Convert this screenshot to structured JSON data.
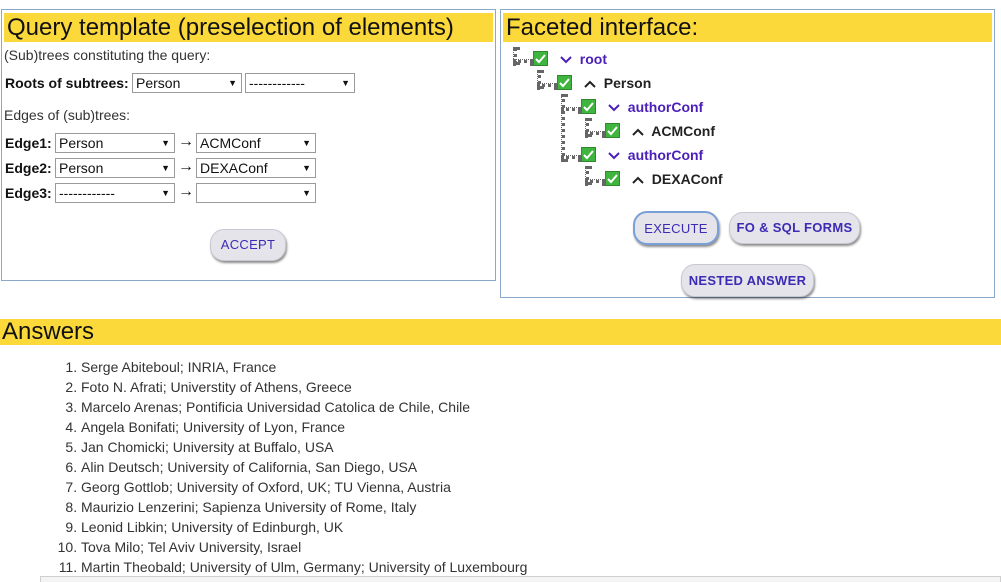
{
  "query_template": {
    "title": "Query template (preselection of elements)",
    "subtrees_caption": "(Sub)trees constituting the query:",
    "roots_label": "Roots of subtrees:",
    "root_select_1": "Person",
    "root_select_2": "------------",
    "edges_caption": "Edges of (sub)trees:",
    "edges": [
      {
        "label": "Edge1:",
        "from": "Person",
        "to": "ACMConf"
      },
      {
        "label": "Edge2:",
        "from": "Person",
        "to": "DEXAConf"
      },
      {
        "label": "Edge3:",
        "from": "------------",
        "to": ""
      }
    ],
    "arrow": "→",
    "accept_label": "ACCEPT"
  },
  "faceted": {
    "title": "Faceted interface:",
    "tree": [
      {
        "label": "root",
        "chevron": "down",
        "color": "#4a1fb8"
      },
      {
        "label": "Person",
        "chevron": "up",
        "color": "#222222"
      },
      {
        "label": "authorConf",
        "chevron": "down",
        "color": "#4a1fb8"
      },
      {
        "label": "ACMConf",
        "chevron": "up",
        "color": "#222222"
      },
      {
        "label": "authorConf",
        "chevron": "down",
        "color": "#4a1fb8"
      },
      {
        "label": "DEXAConf",
        "chevron": "up",
        "color": "#222222"
      }
    ],
    "execute_label": "EXECUTE",
    "fo_sql_label": "FO & SQL FORMS",
    "nested_label": "NESTED ANSWER"
  },
  "answers": {
    "title": "Answers",
    "items": [
      "Serge Abiteboul; INRIA, France",
      "Foto N. Afrati; Universtity of Athens, Greece",
      "Marcelo Arenas; Pontificia Universidad Catolica de Chile, Chile",
      "Angela Bonifati; University of Lyon, France",
      "Jan Chomicki; University at Buffalo, USA",
      "Alin Deutsch; University of California, San Diego, USA",
      "Georg Gottlob; University of Oxford, UK; TU Vienna, Austria",
      "Maurizio Lenzerini; Sapienza University of Rome, Italy",
      "Leonid Libkin; University of Edinburgh, UK",
      "Tova Milo; Tel Aviv University, Israel",
      "Martin Theobald; University of Ulm, Germany; University of Luxembourg"
    ]
  },
  "colors": {
    "header_yellow": "#fcd93a",
    "link_purple": "#4a1fb8",
    "checkbox_green": "#3fb43f",
    "button_text": "#3b2bb5"
  }
}
